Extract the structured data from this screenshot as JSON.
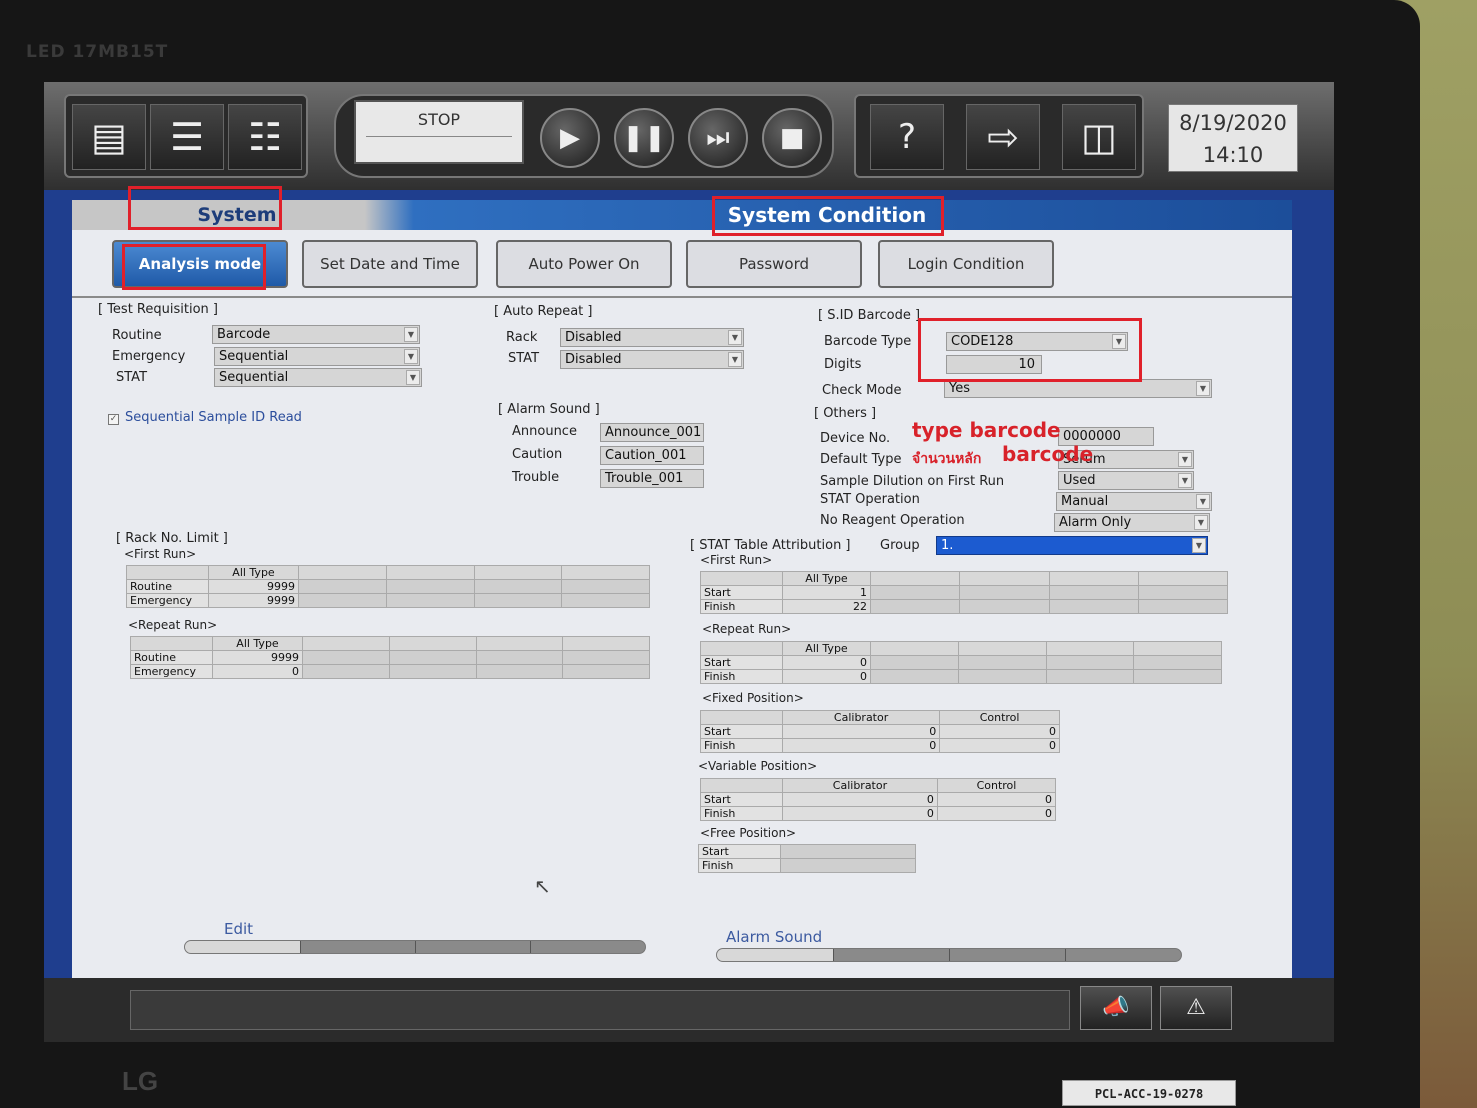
{
  "monitor": {
    "model_text": "LED 17MB15T",
    "brand": "LG",
    "asset_tag": "PCL-ACC-19-0278"
  },
  "toolbar": {
    "status_text": "STOP",
    "date": "8/19/2020",
    "time": "14:10",
    "icons": [
      "rack-icon",
      "list-icon",
      "patient-report-icon",
      "start-icon",
      "pause-icon",
      "step-icon",
      "stop-icon",
      "help-icon",
      "logout-icon",
      "shutdown-icon"
    ]
  },
  "window": {
    "title_left": "System",
    "title_right": "System Condition"
  },
  "tabs": [
    "Analysis mode",
    "Set Date and Time",
    "Auto Power On",
    "Password",
    "Login Condition"
  ],
  "test_requisition": {
    "title": "[ Test Requisition ]",
    "routine_label": "Routine",
    "routine_value": "Barcode",
    "emergency_label": "Emergency",
    "emergency_value": "Sequential",
    "stat_label": "STAT",
    "stat_value": "Sequential",
    "sequential_read_label": "Sequential Sample ID Read"
  },
  "auto_repeat": {
    "title": "[ Auto Repeat ]",
    "rack_label": "Rack",
    "rack_value": "Disabled",
    "stat_label": "STAT",
    "stat_value": "Disabled"
  },
  "alarm_sound": {
    "title": "[ Alarm Sound ]",
    "announce_label": "Announce",
    "announce_value": "Announce_001",
    "caution_label": "Caution",
    "caution_value": "Caution_001",
    "trouble_label": "Trouble",
    "trouble_value": "Trouble_001"
  },
  "sid_barcode": {
    "title": "[ S.ID Barcode ]",
    "type_label": "Barcode Type",
    "type_value": "CODE128",
    "digits_label": "Digits",
    "digits_value": "10",
    "check_label": "Check Mode",
    "check_value": "Yes"
  },
  "others": {
    "title": "[ Others ]",
    "device_label": "Device No.",
    "device_value": "0000000",
    "default_type_label": "Default Type",
    "default_type_value": "Serum",
    "dilution_label": "Sample Dilution on First Run",
    "dilution_value": "Used",
    "stat_op_label": "STAT Operation",
    "stat_op_value": "Manual",
    "no_reagent_label": "No Reagent Operation",
    "no_reagent_value": "Alarm Only"
  },
  "rack_limit": {
    "title": "[ Rack No. Limit ]",
    "first_run_label": "<First Run>",
    "repeat_run_label": "<Repeat Run>",
    "col_header": "All Type",
    "first_run": [
      {
        "label": "Routine",
        "value": "9999"
      },
      {
        "label": "Emergency",
        "value": "9999"
      }
    ],
    "repeat_run": [
      {
        "label": "Routine",
        "value": "9999"
      },
      {
        "label": "Emergency",
        "value": "0"
      }
    ]
  },
  "stat_table": {
    "title": "[ STAT Table Attribution ]",
    "group_label": "Group",
    "group_value": "1.",
    "first_run_label": "<First Run>",
    "repeat_run_label": "<Repeat Run>",
    "fixed_label": "<Fixed Position>",
    "variable_label": "<Variable Position>",
    "free_label": "<Free Position>",
    "all_type": "All Type",
    "calibrator": "Calibrator",
    "control": "Control",
    "start": "Start",
    "finish": "Finish",
    "first_run": {
      "start": "1",
      "finish": "22"
    },
    "repeat_run": {
      "start": "0",
      "finish": "0"
    },
    "fixed": {
      "cal_start": "0",
      "cal_finish": "0",
      "ctl_start": "0",
      "ctl_finish": "0"
    },
    "variable": {
      "cal_start": "0",
      "cal_finish": "0",
      "ctl_start": "0",
      "ctl_finish": "0"
    }
  },
  "progress": {
    "edit_label": "Edit",
    "edit_fraction": 0.25,
    "alarm_label": "Alarm Sound",
    "alarm_fraction": 0.25
  },
  "annotations": {
    "type_barcode": "type barcode",
    "digits_barcode_thai": "จำนวนหลัก",
    "digits_barcode_en": "barcode"
  },
  "colors": {
    "annotation_red": "#e0202a",
    "active_tab": "#2a6ac0",
    "title_blue": "#1c4e9a",
    "selection_blue": "#1c5bd0"
  }
}
